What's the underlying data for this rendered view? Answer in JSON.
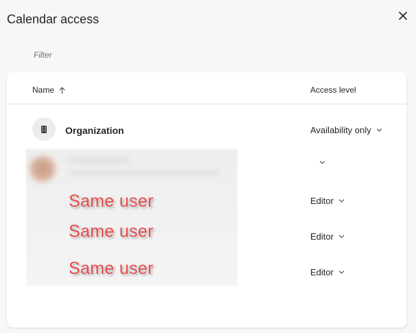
{
  "dialog": {
    "title": "Calendar access"
  },
  "filter": {
    "placeholder": "Filter"
  },
  "table": {
    "columns": {
      "name": "Name",
      "access_level": "Access level"
    },
    "rows": [
      {
        "name": "Organization",
        "access": "Availability only"
      },
      {
        "name": "",
        "access": ""
      },
      {
        "name": "Same user",
        "access": "Editor"
      },
      {
        "name": "Same user",
        "access": "Editor"
      },
      {
        "name": "Same user",
        "access": "Editor"
      }
    ]
  },
  "colors": {
    "annotation_red": "#e34a4a",
    "background": "#f7f7f7",
    "card": "#ffffff"
  },
  "icons": [
    "close-icon",
    "sort-ascending-icon",
    "building-icon",
    "chevron-down-icon"
  ]
}
